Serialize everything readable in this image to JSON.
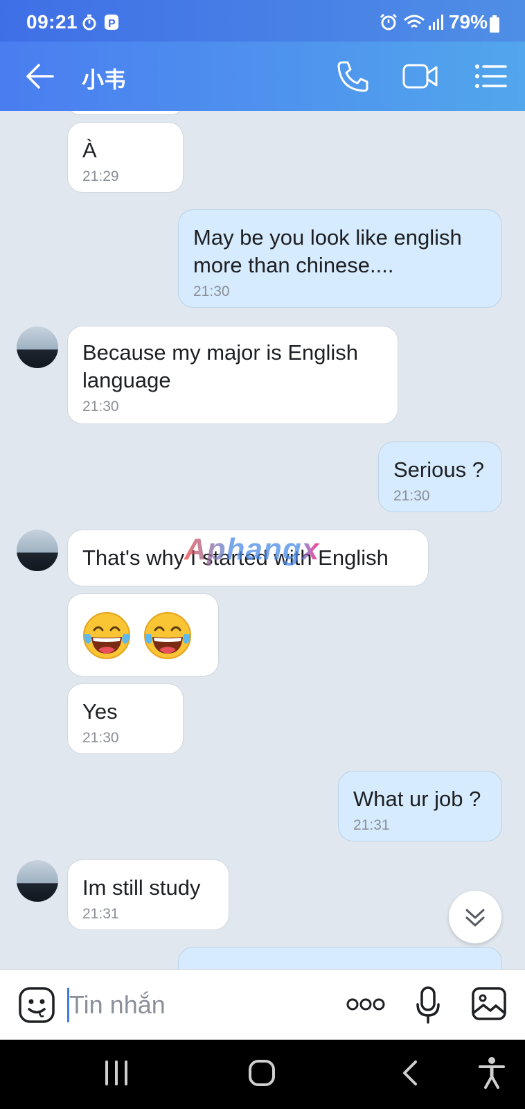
{
  "status_bar": {
    "time": "09:21",
    "battery": "79%",
    "icons": [
      "timer-icon",
      "p-app-icon",
      "alarm-icon",
      "wifi-icon",
      "signal-icon",
      "battery-icon"
    ]
  },
  "header": {
    "title": "小韦",
    "icons": [
      "back-arrow-icon",
      "phone-icon",
      "video-call-icon",
      "menu-icon"
    ]
  },
  "messages": [
    {
      "direction": "in",
      "text": "À",
      "time": "21:29"
    },
    {
      "direction": "out",
      "text": "May be you look like english\nmore than chinese....",
      "time": "21:30"
    },
    {
      "direction": "in",
      "text": "Because my major is English\nlanguage",
      "time": "21:30"
    },
    {
      "direction": "out",
      "text": "Serious ?",
      "time": "21:30"
    },
    {
      "direction": "in",
      "text": "That's why I started with English",
      "time": ""
    },
    {
      "direction": "in",
      "text": "",
      "emoji": [
        "face-with-tears-of-joy",
        "face-with-tears-of-joy"
      ],
      "time": ""
    },
    {
      "direction": "in",
      "text": "Yes",
      "time": "21:30"
    },
    {
      "direction": "out",
      "text": "What ur job ?",
      "time": "21:31"
    },
    {
      "direction": "in",
      "text": "Im still study",
      "time": "21:31"
    }
  ],
  "watermark": "Aphangx",
  "input": {
    "placeholder": "Tin nhắn",
    "icons": [
      "sticker-icon",
      "more-dots-icon",
      "microphone-icon",
      "image-icon"
    ]
  },
  "colors": {
    "header_start": "#4a7df0",
    "header_end": "#52a6ec",
    "chat_bg": "#e1e7ef",
    "outgoing_bubble": "#d6ebfd",
    "incoming_bubble": "#ffffff"
  }
}
